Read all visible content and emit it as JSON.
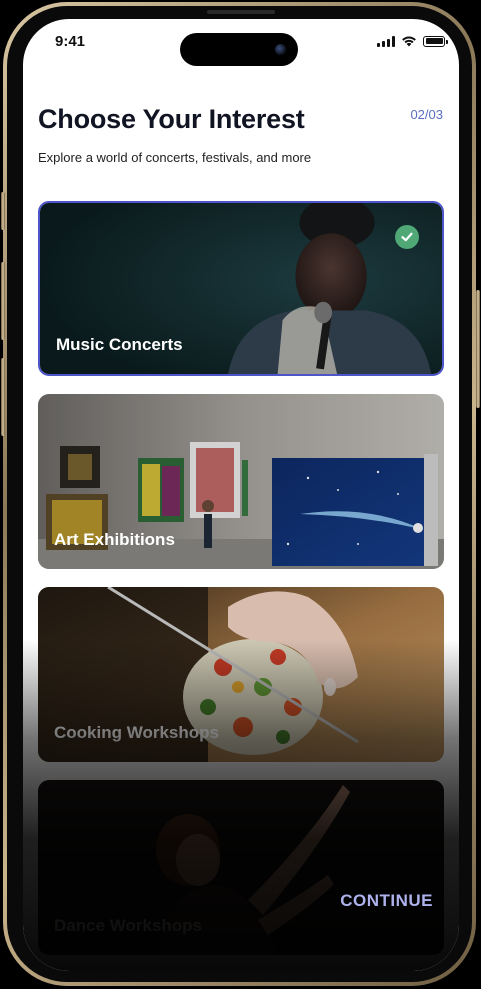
{
  "status_bar": {
    "time": "9:41"
  },
  "header": {
    "title": "Choose Your Interest",
    "step": "02/03",
    "subtitle": "Explore a world of concerts, festivals, and more"
  },
  "interests": [
    {
      "label": "Music Concerts",
      "selected": true
    },
    {
      "label": "Art Exhibitions",
      "selected": false
    },
    {
      "label": "Cooking Workshops",
      "selected": false
    },
    {
      "label": "Dance Workshops",
      "selected": false
    }
  ],
  "actions": {
    "continue_label": "CONTINUE"
  },
  "colors": {
    "accent": "#4d55c9",
    "check": "#4fa876",
    "step_text": "#5a6cc4",
    "continue_text": "#aeb2ec"
  },
  "icons": {
    "check": "check-icon",
    "signal": "signal-icon",
    "wifi": "wifi-icon",
    "battery": "battery-icon"
  }
}
